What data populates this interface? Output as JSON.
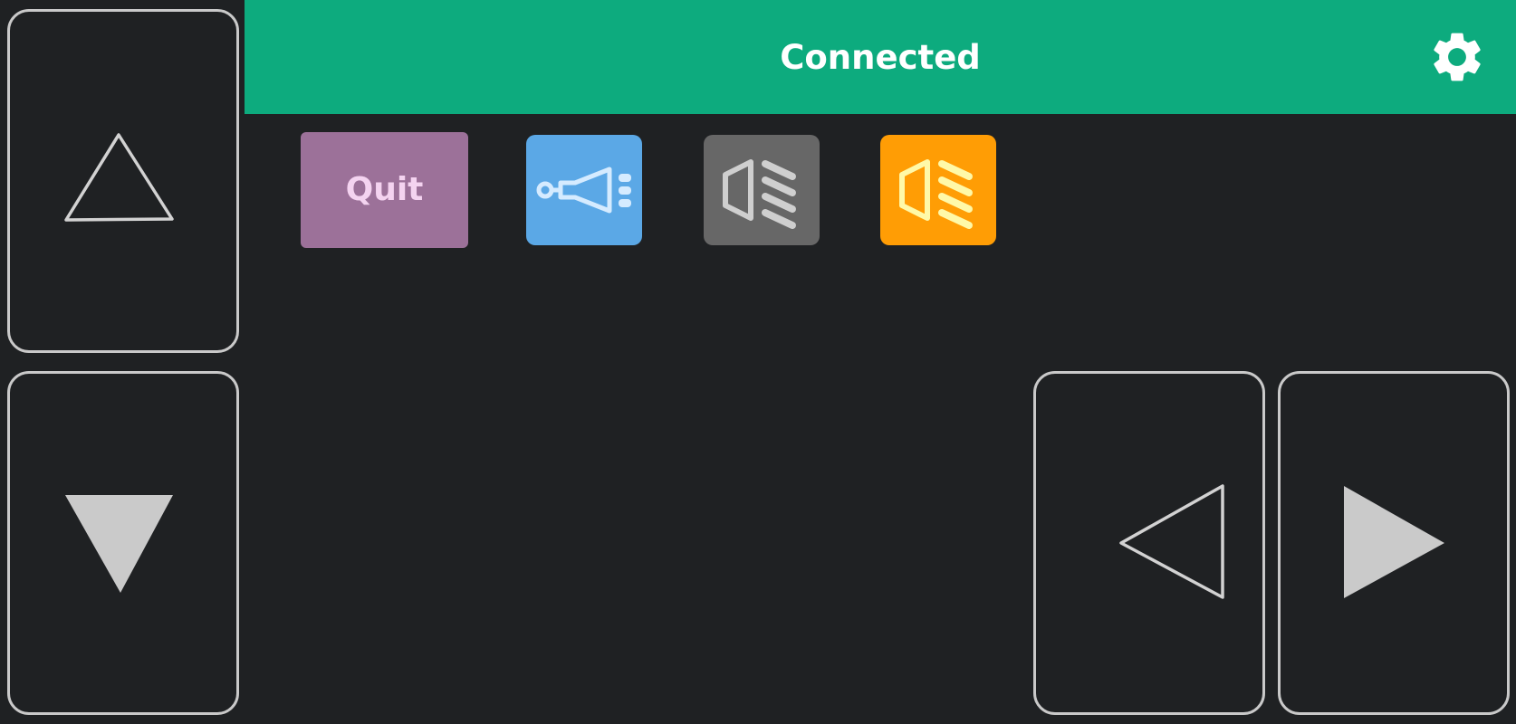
{
  "header": {
    "status": "Connected",
    "background_color": "#0dab7e",
    "settings_icon": "gear-icon"
  },
  "dpad": {
    "up": {
      "icon": "triangle-up-outline-icon"
    },
    "down": {
      "icon": "triangle-down-filled-icon"
    },
    "left": {
      "icon": "triangle-left-outline-icon"
    },
    "right": {
      "icon": "triangle-right-filled-icon"
    }
  },
  "actions": {
    "quit": {
      "label": "Quit",
      "color": "#9c7199"
    },
    "horn": {
      "icon": "horn-icon",
      "color": "#5ba8e6"
    },
    "headlight_off": {
      "icon": "headlight-icon",
      "color": "#676767"
    },
    "headlight_on": {
      "icon": "headlight-icon",
      "color": "#ff9d05"
    }
  }
}
